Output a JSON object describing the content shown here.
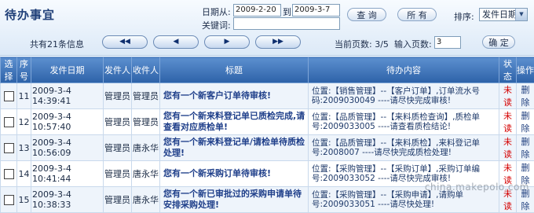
{
  "header": {
    "title": "待办事宜",
    "date_from_label": "日期从:",
    "date_from_value": "2009-2-20",
    "date_to_label": "到",
    "date_to_value": "2009-3-7",
    "keyword_label": "关键词:",
    "keyword_value": "",
    "query_button": "查 询",
    "all_button": "所 有",
    "sort_label": "排序:",
    "sort_selected": "发件日期"
  },
  "pager": {
    "total_text": "共有21条信息",
    "current_page_label": "当前页数: 3/5",
    "input_page_label": "输入页数:",
    "input_page_value": "3",
    "confirm_button": "确 定"
  },
  "table": {
    "headers": [
      "选择",
      "序号",
      "发件日期",
      "发件人",
      "收件人",
      "标题",
      "待办内容",
      "状态",
      "操作"
    ],
    "rows": [
      {
        "no": "11",
        "date": "2009-3-4 14:39:41",
        "sender": "管理员",
        "receiver": "管理员",
        "title": "您有一个新客户订单待审核!",
        "content": "位置:【销售管理】--【客户订单】,订单流水号码:2009030049 ----请尽快完成审核!",
        "status": "未读",
        "action": "删除"
      },
      {
        "no": "12",
        "date": "2009-3-4 10:57:40",
        "sender": "管理员",
        "receiver": "管理员",
        "title": "您有一个新来料登记单已质检完成,请查看对应质检单!",
        "content": "位置:【品质管理】--【来料质检查询】,质检单号:2009033005 ----请查看质检结论!",
        "status": "未读",
        "action": "删除"
      },
      {
        "no": "13",
        "date": "2009-3-4 10:56:09",
        "sender": "管理员",
        "receiver": "唐永华",
        "title": "您有一个新来料登记单/请检单待质检处理!",
        "content": "位置:【品质管理】--【来料质检】,来料登记单号:2008007 ----请尽快完成质检处理!",
        "status": "未读",
        "action": "删除"
      },
      {
        "no": "14",
        "date": "2009-3-4 10:41:44",
        "sender": "管理员",
        "receiver": "唐永华",
        "title": "您有一个新采购订单待审核!",
        "content": "位置:【采购管理】--【采购订单】,采购订单编号:2009033052 ----请尽快完成审核!",
        "status": "未读",
        "action": "删除"
      },
      {
        "no": "15",
        "date": "2009-3-4 10:38:33",
        "sender": "管理员",
        "receiver": "唐永华",
        "title": "您有一个新已审批过的采购申请单待安排采购处理!",
        "content": "位置:【采购管理】--【采购申请】,请购单号:2009033051 ----请尽快处理!",
        "status": "未读",
        "action": "删除"
      }
    ]
  },
  "watermark": "china.makepolo.com",
  "colors": {
    "header_bg": "#2d62a8",
    "unread": "#d40000",
    "title_text": "#1f3f8a"
  }
}
